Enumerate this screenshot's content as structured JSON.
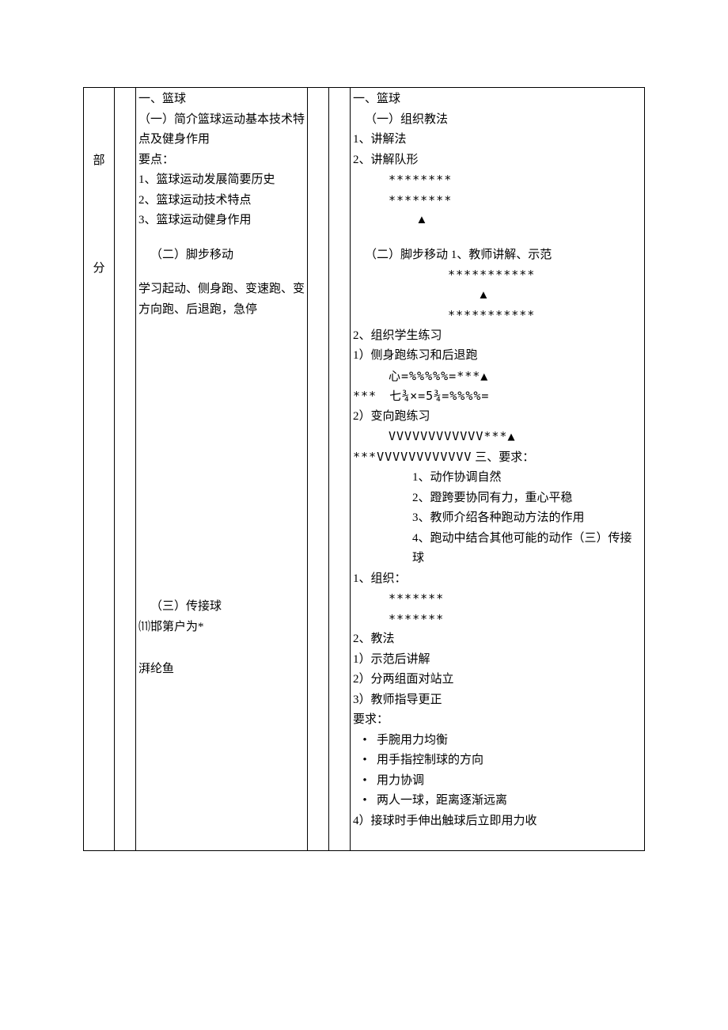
{
  "leftLabel": {
    "char1": "部",
    "char2": "分"
  },
  "col3": {
    "s1_title": "一、篮球",
    "s1_sub1": "（一）简介篮球运动基本技术特点及健身作用",
    "s1_points_label": "要点：",
    "s1_p1": "1、篮球运动发展简要历史",
    "s1_p2": "2、篮球运动技术特点",
    "s1_p3": "3、篮球运动健身作用",
    "s1_sub2": "（二）脚步移动",
    "s1_sub2_body": "学习起动、侧身跑、变速跑、变方向跑、后退跑，急停",
    "s1_sub3": "（三）传接球",
    "garble1": "⑾邯第户为*",
    "garble2": "湃纶鱼"
  },
  "col6": {
    "s1_title": "一、篮球",
    "s1_sub1": "（一）组织教法",
    "m1": "1、讲解法",
    "m2": "2、讲解队形",
    "stars8a": "********",
    "stars8b": "********",
    "triangle": "▲",
    "s1_sub2": "（二）脚步移动 1、教师讲解、示范",
    "stars11a": "***********",
    "stars11b": "***********",
    "m3": "2、组织学生练习",
    "p1": "1）侧身跑练习和后退跑",
    "p1_line1": "心=%%%%%=***▲",
    "p1_line2": "***　七¾×=5¾=%%%%=",
    "p2": "2）变向跑练习",
    "p2_line1": "VVVVVVVVVVVV***▲",
    "p2_line2_prefix": "***VVVVVVVVVVVV",
    "req_title": " 三、要求：",
    "r1": "1、动作协调自然",
    "r2": "2、蹬跨要协同有力，重心平稳",
    "r3": "3、教师介绍各种跑动方法的作用",
    "r4": "4、跑动中结合其他可能的动作（三）传接球",
    "org1": "1、组织：",
    "stars7a": "*******",
    "stars7b": "*******",
    "teach2": "2、教法",
    "t1": "1）示范后讲解",
    "t2": "2）分两组面对站立",
    "t3": "3）教师指导更正",
    "req2_title": "要求：",
    "b1": "手腕用力均衡",
    "b2": "用手指控制球的方向",
    "b3": "用力协调",
    "b4": "两人一球，距离逐渐远离",
    "t4": "4）接球时手伸出触球后立即用力收"
  }
}
